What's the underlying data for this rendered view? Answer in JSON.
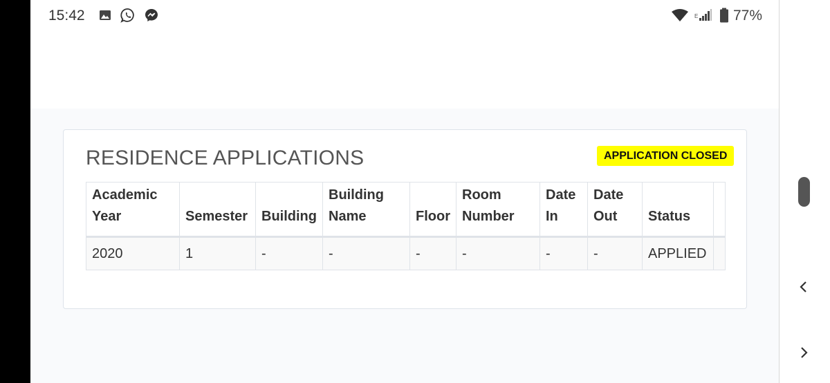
{
  "status_bar": {
    "time": "15:42",
    "left_icons": [
      "image-icon",
      "whatsapp-icon",
      "messenger-icon"
    ],
    "right_icons": [
      "wifi-icon",
      "signal-icon",
      "battery-icon"
    ],
    "battery": "77%"
  },
  "card": {
    "title": "RESIDENCE APPLICATIONS",
    "badge": "APPLICATION CLOSED",
    "badge_color": "#ffff00"
  },
  "table": {
    "columns": [
      [
        "Academic",
        "Year"
      ],
      [
        "",
        "Semester"
      ],
      [
        "",
        "Building"
      ],
      [
        "Building",
        "Name"
      ],
      [
        "",
        "Floor"
      ],
      [
        "Room",
        "Number"
      ],
      [
        "Date",
        "In"
      ],
      [
        "Date",
        "Out"
      ],
      [
        "",
        "Status"
      ]
    ],
    "rows": [
      [
        "2020",
        "1",
        "-",
        "-",
        "-",
        "-",
        "-",
        "-",
        "APPLIED"
      ]
    ]
  },
  "nav": {
    "icons": [
      "scroll-handle",
      "back-chevron-icon",
      "forward-chevron-icon"
    ]
  }
}
